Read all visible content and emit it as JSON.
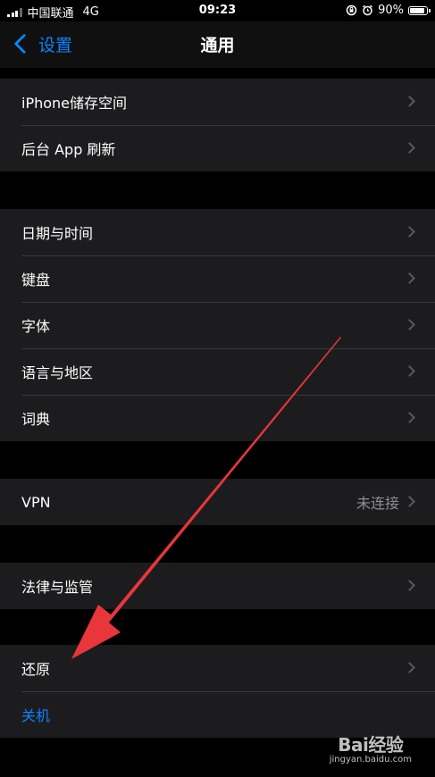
{
  "status_bar": {
    "carrier": "中国联通",
    "network": "4G",
    "time": "09:23",
    "battery_text": "90%",
    "battery_level": 0.9
  },
  "nav": {
    "back_label": "设置",
    "title": "通用"
  },
  "groups": [
    [
      {
        "label": "iPhone储存空间"
      },
      {
        "label": "后台 App 刷新"
      }
    ],
    [
      {
        "label": "日期与时间"
      },
      {
        "label": "键盘"
      },
      {
        "label": "字体"
      },
      {
        "label": "语言与地区"
      },
      {
        "label": "词典"
      }
    ],
    [
      {
        "label": "VPN",
        "value": "未连接"
      }
    ],
    [
      {
        "label": "法律与监管"
      }
    ],
    [
      {
        "label": "还原"
      },
      {
        "label": "关机"
      }
    ]
  ],
  "watermark": {
    "logo": "Bai经验",
    "url": "jingyan.baidu.com"
  },
  "colors": {
    "accent": "#0a84ff",
    "annotation_arrow": "#e8363b"
  }
}
